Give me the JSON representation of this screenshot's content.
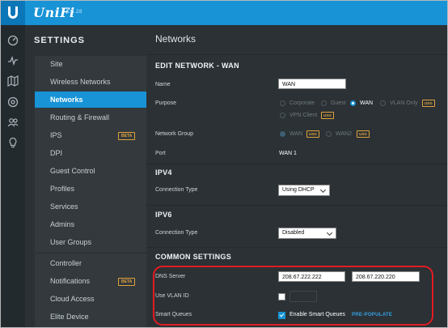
{
  "app": {
    "brand": "UniFi",
    "version": "5.8.28"
  },
  "rail_icons": [
    "dashboard-icon",
    "statistics-icon",
    "map-icon",
    "devices-icon",
    "clients-icon",
    "insights-icon"
  ],
  "sidebar": {
    "title": "SETTINGS",
    "items": [
      {
        "label": "Site"
      },
      {
        "label": "Wireless Networks"
      },
      {
        "label": "Networks"
      },
      {
        "label": "Routing & Firewall"
      },
      {
        "label": "IPS",
        "badge": "BETA"
      },
      {
        "label": "DPI"
      },
      {
        "label": "Guest Control"
      },
      {
        "label": "Profiles"
      },
      {
        "label": "Services"
      },
      {
        "label": "Admins"
      },
      {
        "label": "User Groups"
      },
      {
        "label": "Controller"
      },
      {
        "label": "Notifications",
        "badge": "BETA"
      },
      {
        "label": "Cloud Access"
      },
      {
        "label": "Elite Device"
      }
    ]
  },
  "main": {
    "page_title": "Networks",
    "edit_heading": "EDIT NETWORK - WAN",
    "name": {
      "label": "Name",
      "value": "WAN"
    },
    "purpose": {
      "label": "Purpose",
      "options": {
        "corporate": "Corporate",
        "guest": "Guest",
        "wan": "WAN",
        "vlan_only": "VLAN Only",
        "vpn_client": "VPN Client"
      },
      "usg_badge": "USG",
      "selected": "WAN"
    },
    "network_group": {
      "label": "Network Group",
      "options": {
        "wan": "WAN",
        "wan2": "WAN2"
      },
      "usg_badge": "USG"
    },
    "port": {
      "label": "Port",
      "value": "WAN 1"
    },
    "ipv4": {
      "heading": "IPV4",
      "connection_label": "Connection Type",
      "connection_value": "Using DHCP"
    },
    "ipv6": {
      "heading": "IPV6",
      "connection_label": "Connection Type",
      "connection_value": "Disabled"
    },
    "common": {
      "heading": "COMMON SETTINGS",
      "dns_label": "DNS Server",
      "dns1": "208.67.222.222",
      "dns2": "208.67.220.220",
      "vlan_label": "Use VLAN ID",
      "smart_label": "Smart Queues",
      "smart_checkbox_label": "Enable Smart Queues",
      "prepopulate": "PRE-POPULATE"
    }
  },
  "colors": {
    "accent": "#1793d6",
    "annotation": "#e21b23",
    "badge": "#e0a23a"
  }
}
